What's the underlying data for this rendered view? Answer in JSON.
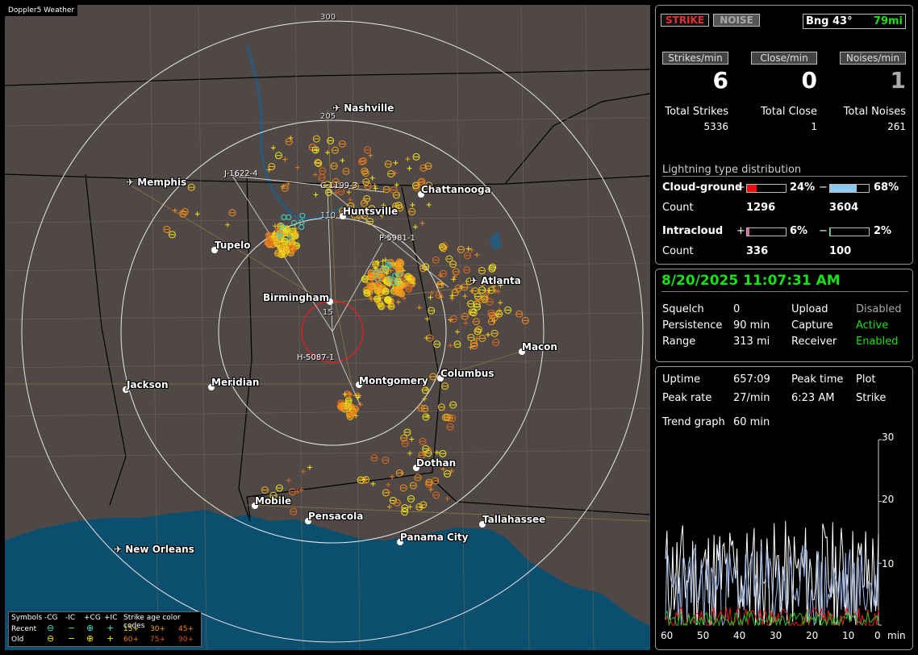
{
  "app_title": "Doppler5 Weather",
  "map": {
    "ring_labels": [
      "300",
      "205",
      "110",
      "15"
    ],
    "cities": [
      {
        "name": "Nashville",
        "airport": true
      },
      {
        "name": "Memphis",
        "airport": true
      },
      {
        "name": "Chattanooga",
        "airport": false
      },
      {
        "name": "Huntsville",
        "airport": false
      },
      {
        "name": "Tupelo",
        "airport": false
      },
      {
        "name": "Atlanta",
        "airport": true
      },
      {
        "name": "Birmingham",
        "airport": false
      },
      {
        "name": "Macon",
        "airport": false
      },
      {
        "name": "Jackson",
        "airport": false
      },
      {
        "name": "Meridian",
        "airport": false
      },
      {
        "name": "Montgomery",
        "airport": false
      },
      {
        "name": "Columbus",
        "airport": false
      },
      {
        "name": "Dothan",
        "airport": false
      },
      {
        "name": "Mobile",
        "airport": false
      },
      {
        "name": "Pensacola",
        "airport": false
      },
      {
        "name": "Tallahassee",
        "airport": false
      },
      {
        "name": "Panama City",
        "airport": false
      },
      {
        "name": "New Orleans",
        "airport": true
      }
    ],
    "sensor_labels": [
      "J-1622-4",
      "C-1199-3",
      "P-5981-1",
      "H-5087-1"
    ],
    "legend": {
      "symbols_label": "Symbols",
      "cols": [
        "-CG",
        "-IC",
        "+CG",
        "+IC"
      ],
      "age_label": "Strike age color codes",
      "recent_label": "Recent",
      "old_label": "Old",
      "recent_ages": [
        "15+",
        "30+",
        "45+"
      ],
      "old_ages": [
        "60+",
        "75+",
        "90+"
      ]
    }
  },
  "status": {
    "strike_btn": "STRIKE",
    "noise_btn": "NOISE",
    "bearing": "Bng 43°",
    "distance": "79mi",
    "rates": [
      {
        "label": "Strikes/min",
        "value": "6",
        "total_label": "Total Strikes",
        "total": "5336"
      },
      {
        "label": "Close/min",
        "value": "0",
        "total_label": "Total Close",
        "total": "1"
      },
      {
        "label": "Noises/min",
        "value": "1",
        "total_label": "Total Noises",
        "total": "261"
      }
    ],
    "dist_title": "Lightning type distribution",
    "cloud_ground": {
      "label": "Cloud-ground",
      "pos_pct": "24%",
      "neg_pct": "68%",
      "pos_count": "1296",
      "neg_count": "3604",
      "pos_fill": 0.24,
      "neg_fill": 0.68
    },
    "intracloud": {
      "label": "Intracloud",
      "pos_pct": "6%",
      "neg_pct": "2%",
      "pos_count": "336",
      "neg_count": "100",
      "pos_fill": 0.06,
      "neg_fill": 0.02
    },
    "count_label": "Count",
    "plus": "+",
    "minus": "−"
  },
  "system": {
    "datetime": "8/20/2025 11:07:31 AM",
    "rows": [
      {
        "k1": "Squelch",
        "v1": "0",
        "k2": "Upload",
        "v2": "Disabled"
      },
      {
        "k1": "Persistence",
        "v1": "90 min",
        "k2": "Capture",
        "v2": "Active"
      },
      {
        "k1": "Range",
        "v1": "313 mi",
        "k2": "Receiver",
        "v2": "Enabled"
      }
    ]
  },
  "trend": {
    "uptime_label": "Uptime",
    "uptime": "657:09",
    "peak_time_label": "Peak time",
    "plot_label": "Plot",
    "peak_rate_label": "Peak rate",
    "peak_rate": "27/min",
    "peak_time": "6:23 AM",
    "plot_value": "Strike",
    "trend_label": "Trend graph",
    "trend_value": "60 min",
    "y_ticks": [
      "30",
      "20",
      "10"
    ],
    "x_ticks": [
      "60",
      "50",
      "40",
      "30",
      "20",
      "10",
      "0"
    ],
    "x_unit": "min"
  },
  "colors": {
    "map_bg": "#4f4847",
    "water": "#0b4e6e",
    "ring": "#e8e8e8",
    "strike_yellow": "#f3e81a",
    "strike_orange": "#f28a1c",
    "ic_cyan": "#3ee0c8",
    "green": "#17e217",
    "red_bar": "#e81010",
    "blue_bar": "#8fc8f0",
    "pink_bar": "#e060a0"
  }
}
